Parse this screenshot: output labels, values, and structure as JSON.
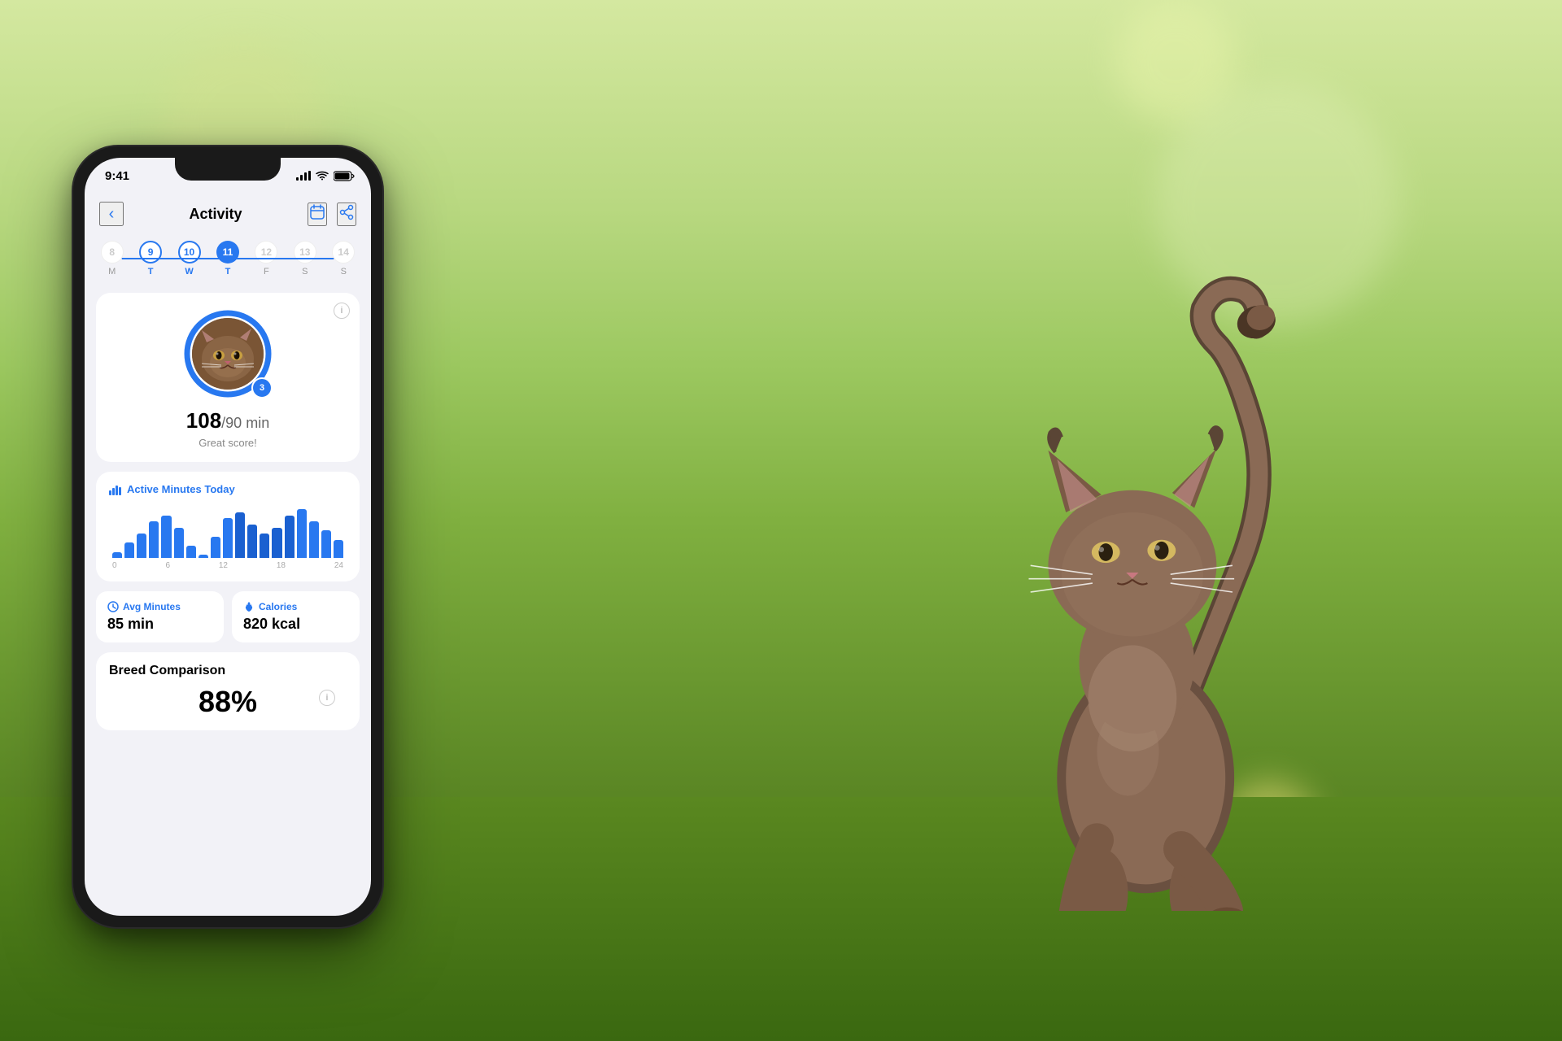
{
  "background": {
    "desc": "outdoor nature scene with blurred cat and green foliage"
  },
  "phone": {
    "status_bar": {
      "time": "9:41",
      "signal": "signal-icon",
      "wifi": "wifi-icon",
      "battery": "battery-icon"
    },
    "header": {
      "back_label": "‹",
      "title": "Activity",
      "calendar_icon": "calendar-icon",
      "share_icon": "share-icon"
    },
    "week": {
      "days": [
        {
          "num": "8",
          "label": "M",
          "state": "none"
        },
        {
          "num": "9",
          "label": "T",
          "state": "past-active"
        },
        {
          "num": "10",
          "label": "W",
          "state": "past-active"
        },
        {
          "num": "11",
          "label": "T",
          "state": "active"
        },
        {
          "num": "12",
          "label": "F",
          "state": "none"
        },
        {
          "num": "13",
          "label": "S",
          "state": "none"
        },
        {
          "num": "14",
          "label": "S",
          "state": "none"
        }
      ]
    },
    "score_card": {
      "info_icon": "info-icon",
      "streak": "3",
      "score_current": "108",
      "score_divider": "/",
      "score_goal": "90 min",
      "score_label": "Great score!"
    },
    "activity_chart": {
      "title": "Active Minutes Today",
      "chart_icon": "bar-chart-icon",
      "bars": [
        2,
        5,
        8,
        12,
        14,
        10,
        4,
        1,
        7,
        13,
        15,
        11,
        8,
        10,
        14,
        16,
        12,
        9,
        6
      ],
      "x_labels": [
        "0",
        "6",
        "12",
        "18",
        "24"
      ]
    },
    "stats": [
      {
        "icon": "clock-icon",
        "title": "Avg Minutes",
        "value": "85 min"
      },
      {
        "icon": "flame-icon",
        "title": "Calories",
        "value": "820 kcal"
      }
    ],
    "breed_comparison": {
      "title": "Breed Comparison",
      "percentage": "88%",
      "info_icon": "info-icon"
    }
  }
}
